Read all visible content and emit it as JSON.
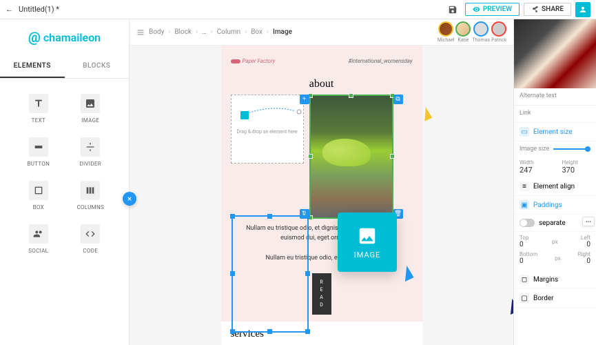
{
  "topbar": {
    "title": "Untitled(1) *",
    "preview": "PREVIEW",
    "share": "SHARE"
  },
  "logo": {
    "text": "chamaileon",
    "at": "@"
  },
  "tabs": {
    "elements": "ELEMENTS",
    "blocks": "BLOCKS"
  },
  "elements": {
    "text": "TEXT",
    "image": "IMAGE",
    "button": "BUTTON",
    "divider": "DIVIDER",
    "box": "BOX",
    "columns": "COLUMNS",
    "social": "SOCIAL",
    "code": "CODE"
  },
  "breadcrumb": {
    "body": "Body",
    "block": "Block",
    "ellipsis": "…",
    "column": "Column",
    "box": "Box",
    "image": "Image"
  },
  "collaborators": [
    {
      "name": "Michael"
    },
    {
      "name": "Katie"
    },
    {
      "name": "Thomas"
    },
    {
      "name": "Patrick"
    }
  ],
  "email": {
    "brand": "Paper Factory",
    "hashtag": "#international_womensday",
    "about": "about",
    "drop_hint": "Drag & drop an element here",
    "para1": "Nullam eu tristique odio, et dignissim ex. Sed vulputate euismod dui, eget ornare erat.",
    "para2": "Nullam eu tristique odio, et dignissim ex.",
    "read": "READ",
    "services": "services"
  },
  "floating": {
    "label": "IMAGE"
  },
  "right": {
    "alt": "Alternate text",
    "link": "Link",
    "element_size": "Element size",
    "image_size": "Image size",
    "width_label": "Width",
    "width_val": "247",
    "height_label": "Height",
    "height_val": "370",
    "element_align": "Element align",
    "paddings": "Paddings",
    "separate": "separate",
    "top": "Top",
    "left": "Left",
    "bottom": "Bottom",
    "right": "Right",
    "px": "px",
    "zero": "0",
    "margins": "Margins",
    "border": "Border"
  }
}
